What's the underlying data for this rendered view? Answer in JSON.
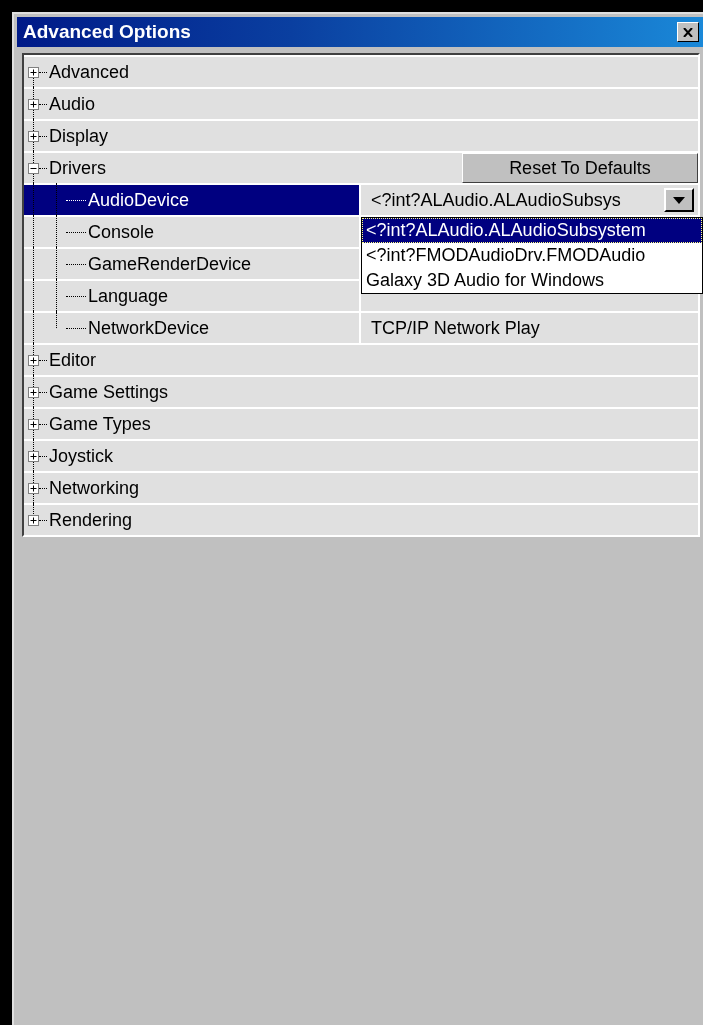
{
  "window": {
    "title": "Advanced Options"
  },
  "tree": [
    {
      "label": "Advanced",
      "expanded": false
    },
    {
      "label": "Audio",
      "expanded": false
    },
    {
      "label": "Display",
      "expanded": false
    },
    {
      "label": "Drivers",
      "expanded": true,
      "button": "Reset To Defaults",
      "children": [
        {
          "label": "AudioDevice",
          "value": "<?int?ALAudio.ALAudioSubsys",
          "selected": true,
          "dropdown": {
            "options": [
              {
                "label": "<?int?ALAudio.ALAudioSubsystem",
                "selected": true
              },
              {
                "label": "<?int?FMODAudioDrv.FMODAudio",
                "selected": false
              },
              {
                "label": "Galaxy 3D Audio for Windows",
                "selected": false
              }
            ]
          }
        },
        {
          "label": "Console",
          "selected": false
        },
        {
          "label": "GameRenderDevice",
          "selected": false
        },
        {
          "label": "Language",
          "selected": false
        },
        {
          "label": "NetworkDevice",
          "value": "TCP/IP Network Play",
          "selected": false
        }
      ]
    },
    {
      "label": "Editor",
      "expanded": false
    },
    {
      "label": "Game Settings",
      "expanded": false
    },
    {
      "label": "Game Types",
      "expanded": false
    },
    {
      "label": "Joystick",
      "expanded": false
    },
    {
      "label": "Networking",
      "expanded": false
    },
    {
      "label": "Rendering",
      "expanded": false
    }
  ]
}
